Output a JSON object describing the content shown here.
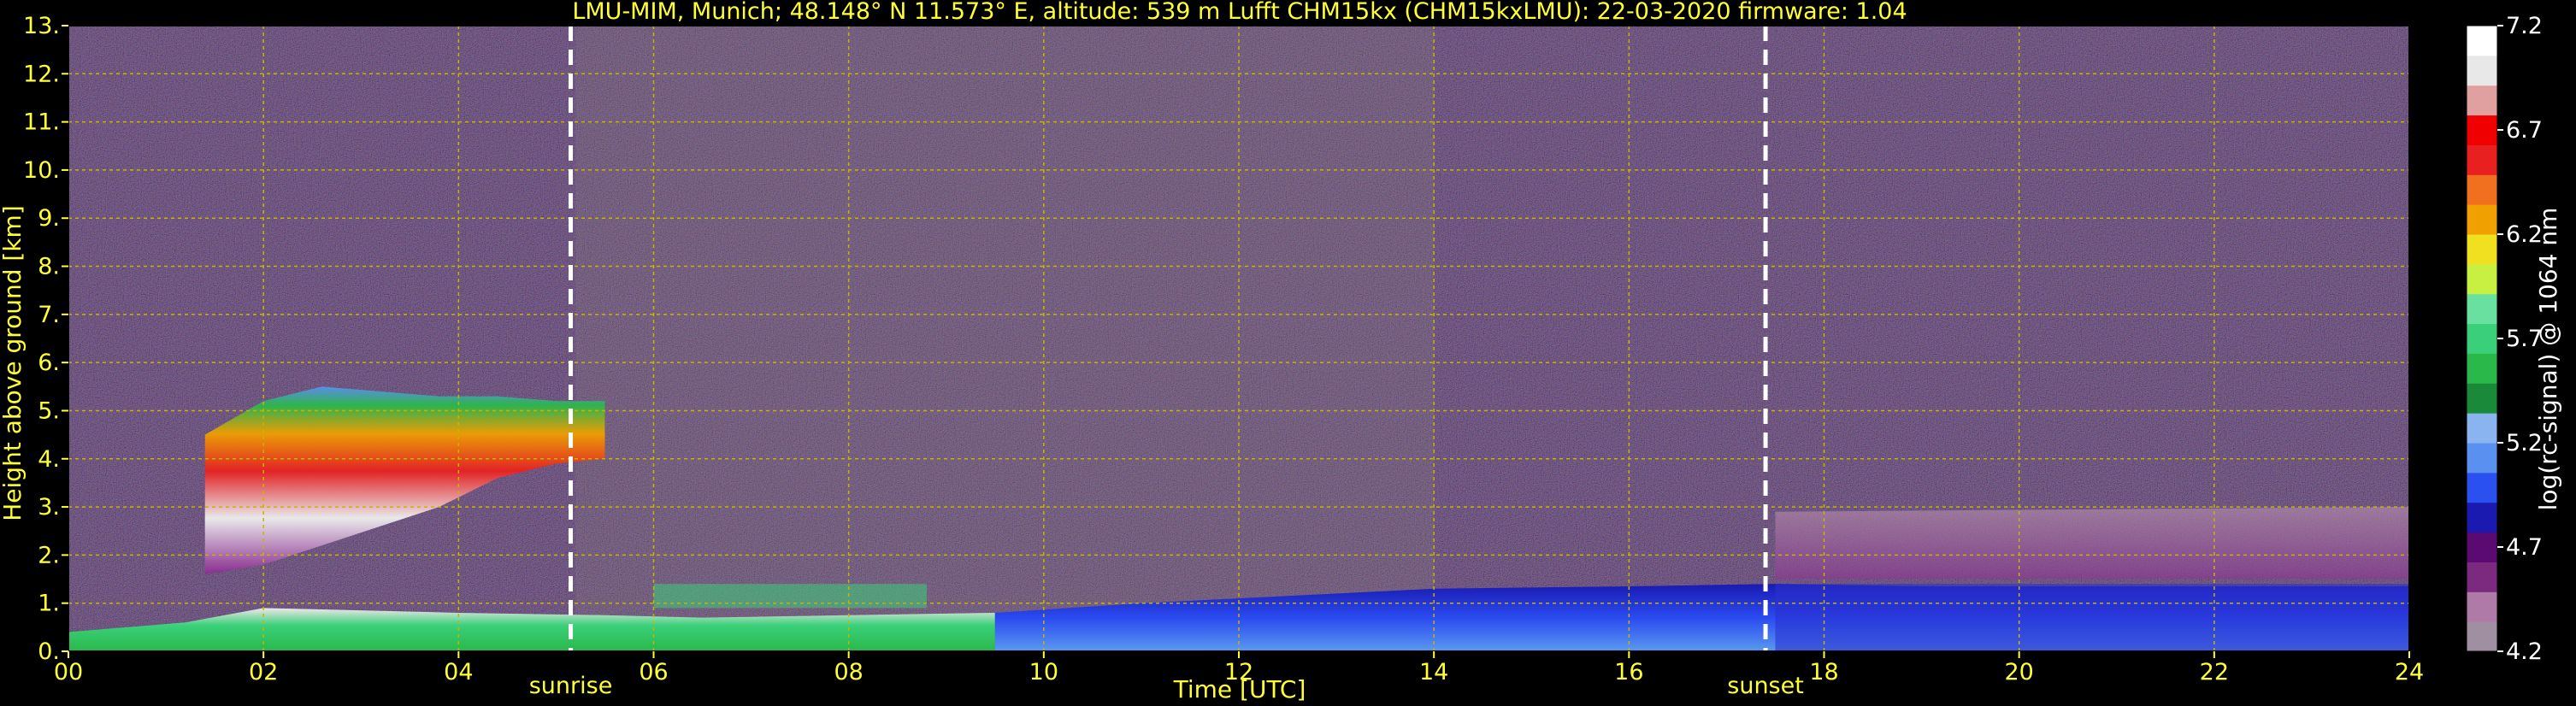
{
  "chart_data": {
    "type": "heatmap",
    "title": "LMU-MIM, Munich; 48.148° N 11.573° E, altitude: 539 m    Lufft CHM15kx (CHM15kxLMU): 22-03-2020    firmware: 1.04",
    "xlabel": "Time [UTC]",
    "ylabel": "Height above ground [km]",
    "xlim": [
      0,
      24
    ],
    "ylim": [
      0,
      13
    ],
    "x_ticks": [
      "00",
      "02",
      "04",
      "06",
      "08",
      "10",
      "12",
      "14",
      "16",
      "18",
      "20",
      "22",
      "24"
    ],
    "y_ticks": [
      "0.",
      "1.",
      "2.",
      "3.",
      "4.",
      "5.",
      "6.",
      "7.",
      "8.",
      "9.",
      "10.",
      "11.",
      "12.",
      "13."
    ],
    "grid": true,
    "colorbar": {
      "label": "log(rc-signal) @ 1064 nm",
      "range": [
        4.2,
        7.2
      ],
      "ticks": [
        "4.2",
        "4.7",
        "5.2",
        "5.7",
        "6.2",
        "6.7",
        "7.2"
      ],
      "colors": [
        "#a08fa0",
        "#b07aa8",
        "#7b2a80",
        "#5a0a70",
        "#1a1ab0",
        "#2a50f0",
        "#5a90f0",
        "#8ab4f0",
        "#1a8a3a",
        "#2ab84a",
        "#3ad07a",
        "#6ae0a0",
        "#c8f040",
        "#f0e020",
        "#f0a000",
        "#f07020",
        "#e82020",
        "#f00000",
        "#e0a0a0",
        "#e8e8e8",
        "#ffffff"
      ]
    },
    "annotations": [
      {
        "label": "sunrise",
        "x": 5.15
      },
      {
        "label": "sunset",
        "x": 17.4
      }
    ],
    "layers": [
      {
        "name": "boundary-layer-night",
        "x": [
          0,
          1.2,
          2,
          4,
          5.5,
          6.5,
          8,
          9.5
        ],
        "top": [
          0.4,
          0.6,
          0.9,
          0.8,
          0.75,
          0.7,
          0.75,
          0.8
        ]
      },
      {
        "name": "boundary-layer-day",
        "x": [
          9.5,
          11,
          12.5,
          14,
          16,
          17.5,
          19,
          21,
          24
        ],
        "top": [
          0.8,
          1.0,
          1.15,
          1.3,
          1.35,
          1.4,
          1.35,
          1.35,
          1.35
        ]
      },
      {
        "name": "cloud-layer",
        "x": [
          1.4,
          2.0,
          2.6,
          3.2,
          3.8,
          4.4,
          5.0,
          5.5
        ],
        "bottom": [
          1.6,
          1.8,
          2.2,
          2.6,
          3.0,
          3.6,
          3.9,
          4.0
        ],
        "top": [
          4.5,
          5.2,
          5.5,
          5.4,
          5.3,
          5.3,
          5.2,
          5.2
        ]
      },
      {
        "name": "aerosol-layer-evening",
        "x": [
          17.5,
          24
        ],
        "bottom": [
          1.5,
          1.5
        ],
        "top": [
          2.9,
          3.0
        ]
      }
    ]
  }
}
